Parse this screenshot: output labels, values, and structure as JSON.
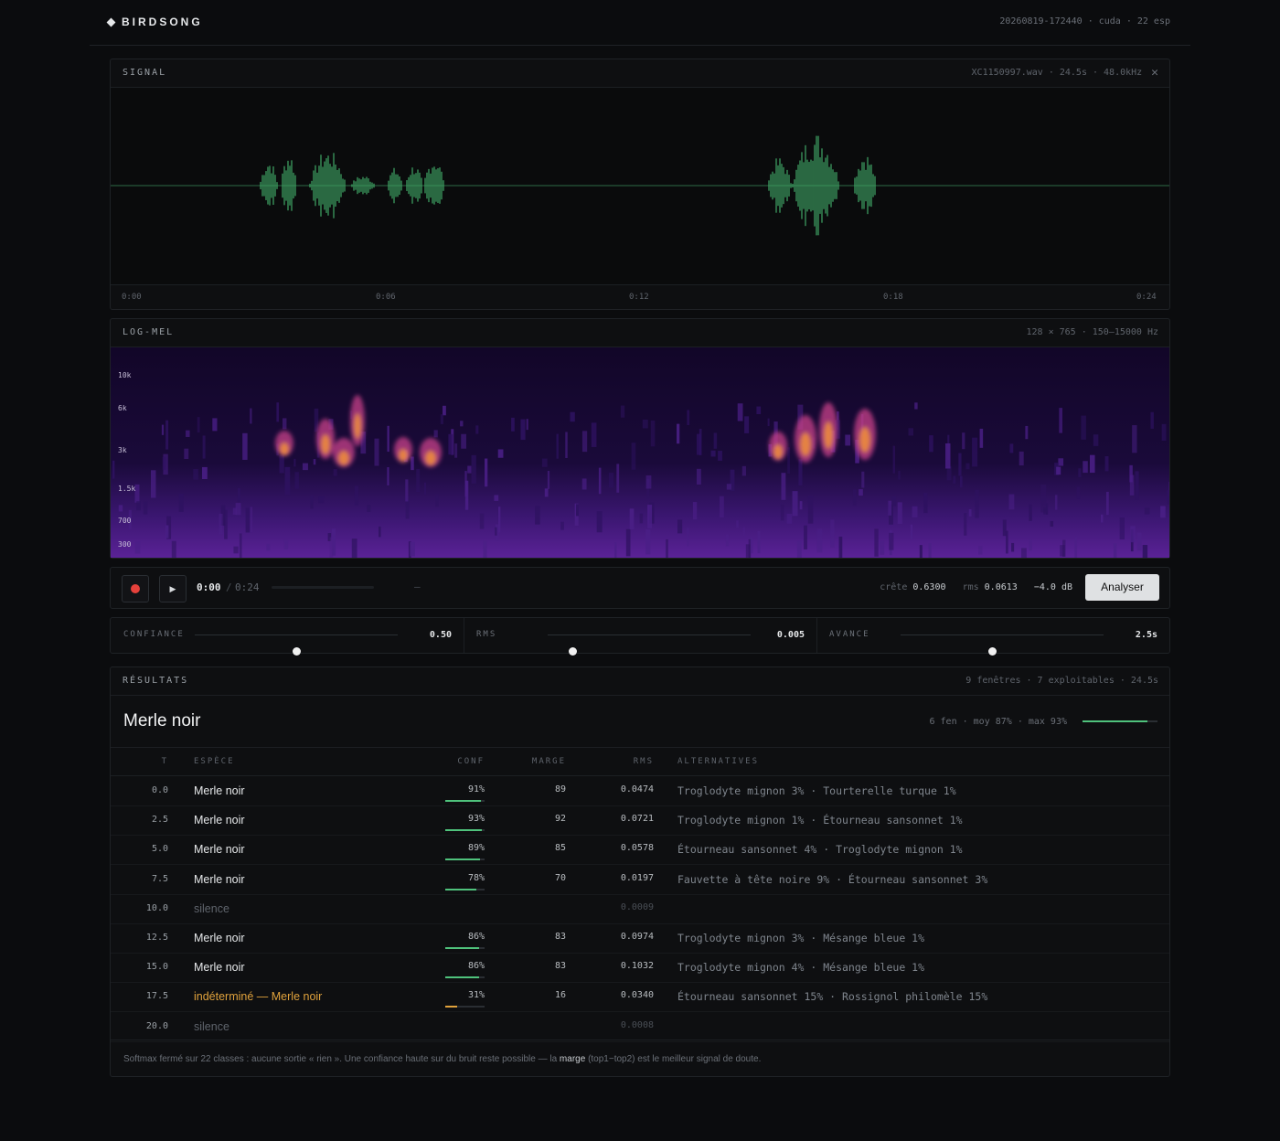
{
  "header": {
    "brand": "BIRDSONG",
    "meta": "20260819-172440 · cuda · 22 esp"
  },
  "signal": {
    "title": "SIGNAL",
    "meta": "XC1150997.wav · 24.5s · 48.0kHz",
    "ticks": [
      "0:00",
      "0:06",
      "0:12",
      "0:18",
      "0:24"
    ]
  },
  "logmel": {
    "title": "LOG-MEL",
    "meta": "128 × 765 · 150–15000 Hz",
    "freq_labels": [
      "10k",
      "6k",
      "3k",
      "1.5k",
      "700",
      "300"
    ]
  },
  "player": {
    "current": "0:00",
    "separator": "/",
    "total": "0:24",
    "progress": 0,
    "dash": "—",
    "peak_label": "crête",
    "peak_value": "0.6300",
    "rms_label": "rms",
    "rms_value": "0.0613",
    "db": "−4.0 dB",
    "analyze_label": "Analyser"
  },
  "params": [
    {
      "label": "CONFIANCE",
      "value": "0.50",
      "level": 0.5
    },
    {
      "label": "RMS",
      "value": "0.005",
      "level": 0.12
    },
    {
      "label": "AVANCE",
      "value": "2.5s",
      "level": 0.45
    }
  ],
  "results": {
    "title": "RÉSULTATS",
    "meta": "9 fenêtres · 7 exploitables · 24.5s",
    "top_species": "Merle noir",
    "summary": "6 fen · moy 87% · max 93%",
    "summary_level": 0.87,
    "columns": {
      "t": "T",
      "species": "ESPÈCE",
      "conf": "CONF",
      "margin": "MARGE",
      "rms": "RMS",
      "alternatives": "ALTERNATIVES"
    },
    "rows": [
      {
        "t": "0.0",
        "species": "Merle noir",
        "conf": "91%",
        "level": 0.91,
        "margin": "89",
        "rms": "0.0474",
        "alt": "Troglodyte mignon 3% · Tourterelle turque 1%",
        "kind": "ok"
      },
      {
        "t": "2.5",
        "species": "Merle noir",
        "conf": "93%",
        "level": 0.93,
        "margin": "92",
        "rms": "0.0721",
        "alt": "Troglodyte mignon 1% · Étourneau sansonnet 1%",
        "kind": "ok"
      },
      {
        "t": "5.0",
        "species": "Merle noir",
        "conf": "89%",
        "level": 0.89,
        "margin": "85",
        "rms": "0.0578",
        "alt": "Étourneau sansonnet 4% · Troglodyte mignon 1%",
        "kind": "ok"
      },
      {
        "t": "7.5",
        "species": "Merle noir",
        "conf": "78%",
        "level": 0.78,
        "margin": "70",
        "rms": "0.0197",
        "alt": "Fauvette à tête noire 9% · Étourneau sansonnet 3%",
        "kind": "ok"
      },
      {
        "t": "10.0",
        "species": "silence",
        "conf": "",
        "level": 0,
        "margin": "",
        "rms": "0.0009",
        "alt": "",
        "kind": "silence"
      },
      {
        "t": "12.5",
        "species": "Merle noir",
        "conf": "86%",
        "level": 0.86,
        "margin": "83",
        "rms": "0.0974",
        "alt": "Troglodyte mignon 3% · Mésange bleue 1%",
        "kind": "ok"
      },
      {
        "t": "15.0",
        "species": "Merle noir",
        "conf": "86%",
        "level": 0.86,
        "margin": "83",
        "rms": "0.1032",
        "alt": "Troglodyte mignon 4% · Mésange bleue 1%",
        "kind": "ok"
      },
      {
        "t": "17.5",
        "species": "indéterminé — Merle noir",
        "conf": "31%",
        "level": 0.31,
        "margin": "16",
        "rms": "0.0340",
        "alt": "Étourneau sansonnet 15% · Rossignol philomèle 15%",
        "kind": "undetermined"
      },
      {
        "t": "20.0",
        "species": "silence",
        "conf": "",
        "level": 0,
        "margin": "",
        "rms": "0.0008",
        "alt": "",
        "kind": "silence"
      }
    ],
    "footnote_pre": "Softmax fermé sur 22 classes : aucune sortie « rien ». Une confiance haute sur du bruit reste possible — la",
    "footnote_bold": "marge",
    "footnote_post": "(top1−top2) est le meilleur signal de doute."
  },
  "colors": {
    "accent": "#4fc27c",
    "warning": "#e0a23c",
    "record": "#e5413b",
    "wave": "#3fa866"
  }
}
